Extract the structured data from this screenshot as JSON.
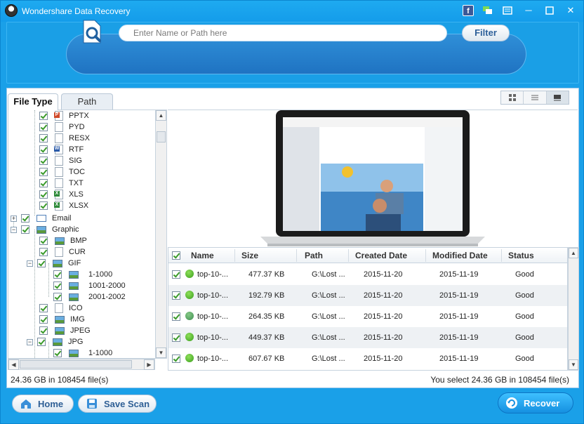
{
  "window": {
    "title": "Wondershare Data Recovery",
    "controls": {
      "facebook": "f",
      "minimize": "─",
      "close": "✕"
    }
  },
  "search": {
    "placeholder": "Enter Name or Path here",
    "filter_label": "Filter"
  },
  "tabs": [
    {
      "label": "File Type",
      "active": true
    },
    {
      "label": "Path",
      "active": false
    }
  ],
  "view_modes": [
    "thumbnail-view-icon",
    "list-view-icon",
    "preview-view-icon"
  ],
  "tree": [
    {
      "label": "PPTX",
      "icon": "pdf-file-icon",
      "level": 2
    },
    {
      "label": "PYD",
      "icon": "file-icon",
      "level": 2
    },
    {
      "label": "RESX",
      "icon": "file-icon",
      "level": 2
    },
    {
      "label": "RTF",
      "icon": "word-file-icon",
      "level": 2
    },
    {
      "label": "SIG",
      "icon": "file-icon",
      "level": 2
    },
    {
      "label": "TOC",
      "icon": "file-icon",
      "level": 2
    },
    {
      "label": "TXT",
      "icon": "file-icon",
      "level": 2
    },
    {
      "label": "XLS",
      "icon": "excel-file-icon",
      "level": 2
    },
    {
      "label": "XLSX",
      "icon": "excel-file-icon",
      "level": 2
    },
    {
      "label": "Email",
      "icon": "email-icon",
      "level": 1,
      "expander": "+"
    },
    {
      "label": "Graphic",
      "icon": "image-icon",
      "level": 1,
      "expander": "−"
    },
    {
      "label": "BMP",
      "icon": "image-icon",
      "level": 2
    },
    {
      "label": "CUR",
      "icon": "file-icon",
      "level": 2
    },
    {
      "label": "GIF",
      "icon": "image-icon",
      "level": 2,
      "expander": "−"
    },
    {
      "label": "1-1000",
      "icon": "image-icon",
      "level": 3
    },
    {
      "label": "1001-2000",
      "icon": "image-icon",
      "level": 3
    },
    {
      "label": "2001-2002",
      "icon": "image-icon",
      "level": 3
    },
    {
      "label": "ICO",
      "icon": "file-icon",
      "level": 2
    },
    {
      "label": "IMG",
      "icon": "image-icon",
      "level": 2
    },
    {
      "label": "JPEG",
      "icon": "image-icon",
      "level": 2
    },
    {
      "label": "JPG",
      "icon": "image-icon",
      "level": 2,
      "expander": "−"
    },
    {
      "label": "1-1000",
      "icon": "image-icon",
      "level": 3
    }
  ],
  "table": {
    "headers": [
      "Name",
      "Size",
      "Path",
      "Created Date",
      "Modified Date",
      "Status"
    ],
    "rows": [
      {
        "name": "top-10-...",
        "size": "477.37 KB",
        "path": "G:\\Lost ...",
        "created": "2015-11-20",
        "modified": "2015-11-19",
        "status": "Good"
      },
      {
        "name": "top-10-...",
        "size": "192.79 KB",
        "path": "G:\\Lost ...",
        "created": "2015-11-20",
        "modified": "2015-11-19",
        "status": "Good"
      },
      {
        "name": "top-10-...",
        "size": "264.35 KB",
        "path": "G:\\Lost ...",
        "created": "2015-11-20",
        "modified": "2015-11-19",
        "status": "Good"
      },
      {
        "name": "top-10-...",
        "size": "449.37 KB",
        "path": "G:\\Lost ...",
        "created": "2015-11-20",
        "modified": "2015-11-19",
        "status": "Good"
      },
      {
        "name": "top-10-...",
        "size": "607.67 KB",
        "path": "G:\\Lost ...",
        "created": "2015-11-20",
        "modified": "2015-11-19",
        "status": "Good"
      }
    ]
  },
  "status": {
    "total": "24.36 GB in 108454 file(s)",
    "selected": "You select 24.36 GB in 108454 file(s)"
  },
  "buttons": {
    "home": "Home",
    "save_scan": "Save Scan",
    "recover": "Recover"
  },
  "colors": {
    "accent": "#1aa0e8",
    "status_good": "#3a9e1e",
    "recover_button": "#1590e0"
  }
}
